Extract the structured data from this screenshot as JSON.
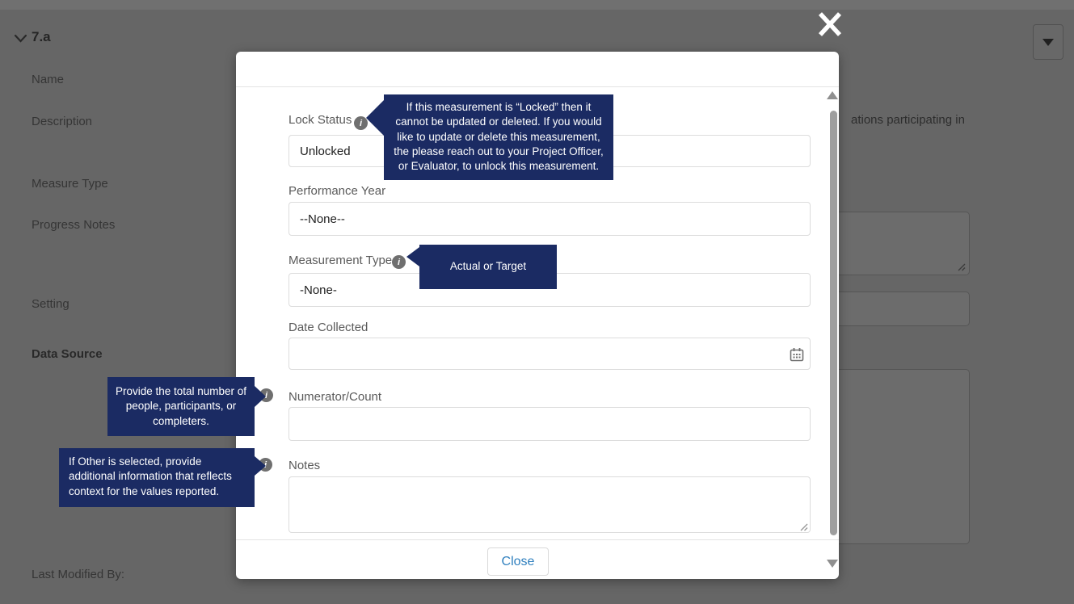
{
  "background": {
    "section_title": "7.a",
    "name_label": "Name",
    "description_label": "Description",
    "measure_type_label": "Measure Type",
    "progress_notes_label": "Progress Notes",
    "setting_label": "Setting",
    "data_source_label": "Data Source",
    "last_modified_label": "Last Modified By:",
    "description_fragment": "ations participating in"
  },
  "modal": {
    "lock_status_label": "Lock Status",
    "lock_status_value": "Unlocked",
    "performance_year_label": "Performance Year",
    "performance_year_value": "--None--",
    "measurement_type_label": "Measurement Type",
    "measurement_type_value": "-None-",
    "date_collected_label": "Date Collected",
    "date_collected_value": "",
    "numerator_label": "Numerator/Count",
    "numerator_value": "",
    "notes_label": "Notes",
    "notes_value": "",
    "close_button_label": "Close"
  },
  "tooltips": {
    "lock_status": "If this measurement is “Locked” then it cannot be updated or deleted. If you would like to update or delete this measurement, the please reach out to your Project Officer, or Evaluator, to unlock this measurement.",
    "measurement_type": "Actual or Target",
    "numerator": "Provide the total number of people, participants, or completers.",
    "notes": "If Other is selected, provide additional information that reflects context for the values reported."
  },
  "colors": {
    "tooltip_bg": "#1b2b63",
    "close_button_text": "#2e7fbe",
    "overlay": "rgba(0,0,0,0.56)",
    "info_icon_bg": "#6f6f6f"
  }
}
